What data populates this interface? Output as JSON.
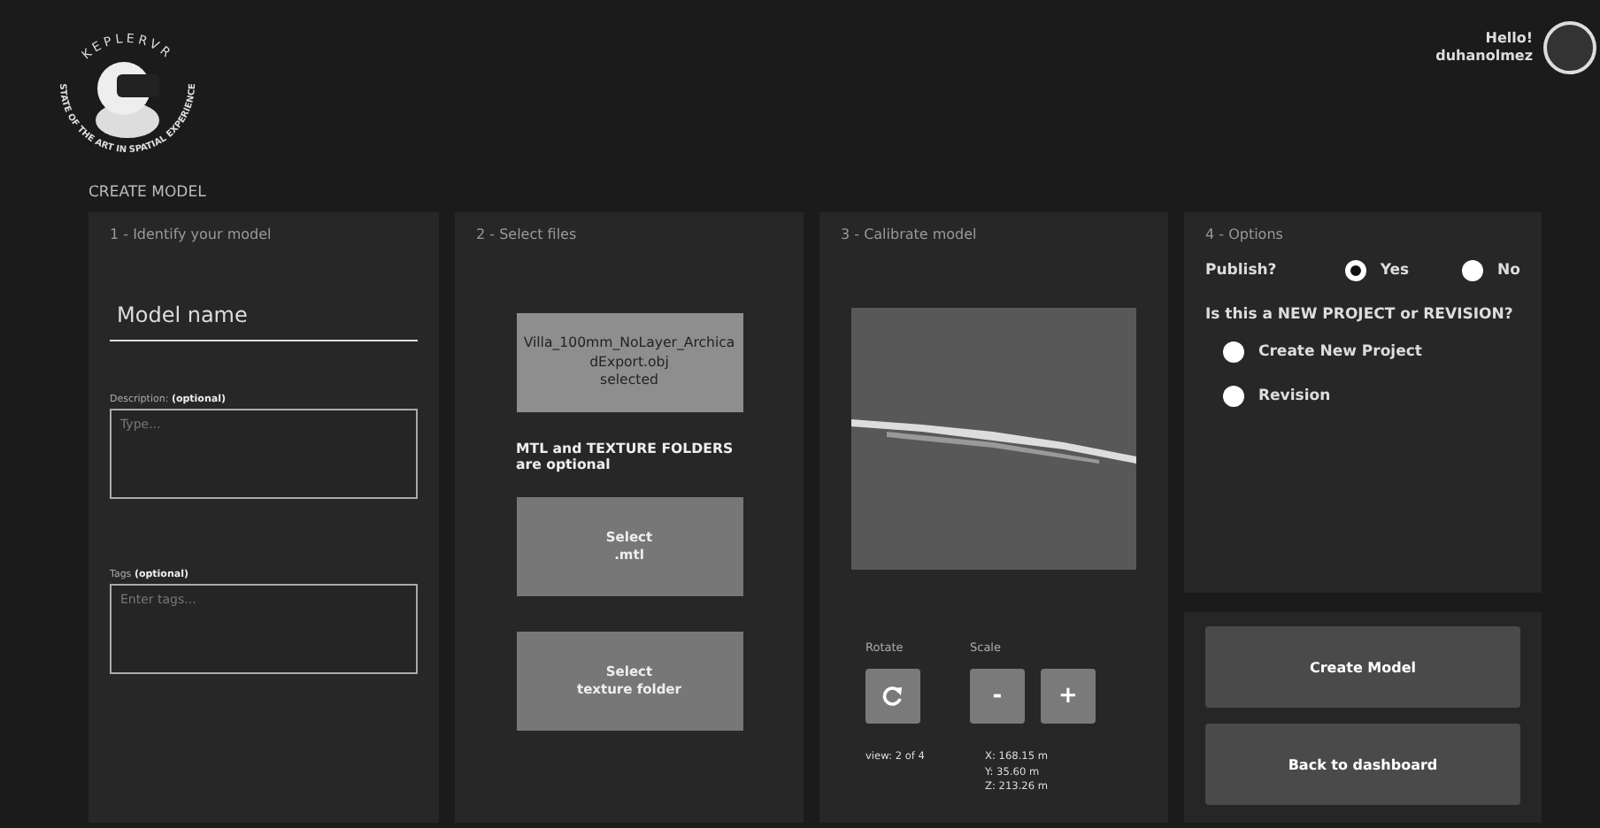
{
  "logo": {
    "name": "KEPLERVR",
    "tagline": "STATE OF THE ART IN SPATIAL EXPERIENCE"
  },
  "user": {
    "greeting": "Hello!",
    "name": "duhanolmez"
  },
  "page_title": "CREATE MODEL",
  "identify": {
    "title": "1 - Identify your model",
    "name_placeholder": "Model name",
    "description_label": "Description: **(optional)**",
    "description_placeholder": "Type...",
    "tags_label": "Tags **(optional)**",
    "tags_placeholder": "Enter tags..."
  },
  "files": {
    "title": "2 - Select files",
    "obj_button": "Villa_100mm_NoLayer_ArchicadExport.obj\nselected",
    "note": "MTL and TEXTURE FOLDERS\nare optional",
    "mtl_button": "Select\n.mtl",
    "texture_button": "Select\ntexture folder"
  },
  "calibrate": {
    "title": "3 - Calibrate model",
    "rotate_label": "Rotate",
    "scale_label": "Scale",
    "minus": "-",
    "plus": "+",
    "view": "view: 2 of 4",
    "coords": [
      "X: 168.15 m",
      "Y: 35.60 m",
      "Z: 213.26 m"
    ]
  },
  "options": {
    "title": "4 - Options",
    "publish_label": "Publish?",
    "publish": [
      {
        "label": "Yes",
        "selected": true
      },
      {
        "label": "No",
        "selected": false
      }
    ],
    "question": "Is this a NEW PROJECT or REVISION?",
    "project": [
      {
        "label": "Create New Project",
        "selected": false
      },
      {
        "label": "Revision",
        "selected": false
      }
    ]
  },
  "actions": [
    "Create Model",
    "Back to dashboard"
  ]
}
